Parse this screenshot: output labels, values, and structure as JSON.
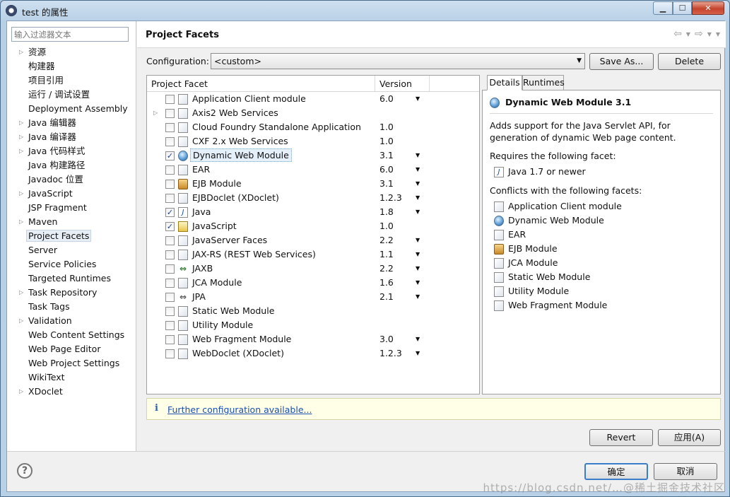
{
  "window": {
    "title": "test 的属性"
  },
  "filter": {
    "placeholder": "输入过滤器文本"
  },
  "nav": [
    {
      "label": "资源",
      "expandable": true
    },
    {
      "label": "构建器",
      "expandable": false
    },
    {
      "label": "项目引用",
      "expandable": false
    },
    {
      "label": "运行 / 调试设置",
      "expandable": false
    },
    {
      "label": "Deployment Assembly",
      "expandable": false
    },
    {
      "label": "Java 编辑器",
      "expandable": true
    },
    {
      "label": "Java 编译器",
      "expandable": true
    },
    {
      "label": "Java 代码样式",
      "expandable": true
    },
    {
      "label": "Java 构建路径",
      "expandable": false
    },
    {
      "label": "Javadoc 位置",
      "expandable": false
    },
    {
      "label": "JavaScript",
      "expandable": true
    },
    {
      "label": "JSP Fragment",
      "expandable": false
    },
    {
      "label": "Maven",
      "expandable": true
    },
    {
      "label": "Project Facets",
      "expandable": false,
      "selected": true
    },
    {
      "label": "Server",
      "expandable": false
    },
    {
      "label": "Service Policies",
      "expandable": false
    },
    {
      "label": "Targeted Runtimes",
      "expandable": false
    },
    {
      "label": "Task Repository",
      "expandable": true
    },
    {
      "label": "Task Tags",
      "expandable": false
    },
    {
      "label": "Validation",
      "expandable": true
    },
    {
      "label": "Web Content Settings",
      "expandable": false
    },
    {
      "label": "Web Page Editor",
      "expandable": false
    },
    {
      "label": "Web Project Settings",
      "expandable": false
    },
    {
      "label": "WikiText",
      "expandable": false
    },
    {
      "label": "XDoclet",
      "expandable": true
    }
  ],
  "page": {
    "title": "Project Facets"
  },
  "config": {
    "label": "Configuration:",
    "value": "<custom>",
    "save_as": "Save As...",
    "delete": "Delete"
  },
  "facets": {
    "col_facet": "Project Facet",
    "col_version": "Version",
    "rows": [
      {
        "name": "Application Client module",
        "version": "6.0",
        "checked": false,
        "dropdown": true,
        "icon": "page-icon",
        "expandable": false
      },
      {
        "name": "Axis2 Web Services",
        "version": "",
        "checked": false,
        "dropdown": false,
        "icon": "page-icon",
        "expandable": true
      },
      {
        "name": "Cloud Foundry Standalone Application",
        "version": "1.0",
        "checked": false,
        "dropdown": false,
        "icon": "page-icon",
        "expandable": false
      },
      {
        "name": "CXF 2.x Web Services",
        "version": "1.0",
        "checked": false,
        "dropdown": false,
        "icon": "page-icon",
        "expandable": false
      },
      {
        "name": "Dynamic Web Module",
        "version": "3.1",
        "checked": true,
        "dropdown": true,
        "icon": "globe-icon",
        "expandable": false,
        "selected": true
      },
      {
        "name": "EAR",
        "version": "6.0",
        "checked": false,
        "dropdown": true,
        "icon": "page-icon",
        "expandable": false
      },
      {
        "name": "EJB Module",
        "version": "3.1",
        "checked": false,
        "dropdown": true,
        "icon": "jar-icon",
        "expandable": false
      },
      {
        "name": "EJBDoclet (XDoclet)",
        "version": "1.2.3",
        "checked": false,
        "dropdown": true,
        "icon": "page-icon",
        "expandable": false
      },
      {
        "name": "Java",
        "version": "1.8",
        "checked": true,
        "dropdown": true,
        "icon": "java-icon",
        "expandable": false
      },
      {
        "name": "JavaScript",
        "version": "1.0",
        "checked": true,
        "dropdown": false,
        "icon": "js-icon",
        "expandable": false
      },
      {
        "name": "JavaServer Faces",
        "version": "2.2",
        "checked": false,
        "dropdown": true,
        "icon": "page-icon",
        "expandable": false
      },
      {
        "name": "JAX-RS (REST Web Services)",
        "version": "1.1",
        "checked": false,
        "dropdown": true,
        "icon": "page-icon",
        "expandable": false
      },
      {
        "name": "JAXB",
        "version": "2.2",
        "checked": false,
        "dropdown": true,
        "icon": "arrows-icon",
        "expandable": false
      },
      {
        "name": "JCA Module",
        "version": "1.6",
        "checked": false,
        "dropdown": true,
        "icon": "page-icon",
        "expandable": false
      },
      {
        "name": "JPA",
        "version": "2.1",
        "checked": false,
        "dropdown": true,
        "icon": "arrows-gray-icon",
        "expandable": false
      },
      {
        "name": "Static Web Module",
        "version": "",
        "checked": false,
        "dropdown": false,
        "icon": "page-icon",
        "expandable": false
      },
      {
        "name": "Utility Module",
        "version": "",
        "checked": false,
        "dropdown": false,
        "icon": "page-icon",
        "expandable": false
      },
      {
        "name": "Web Fragment Module",
        "version": "3.0",
        "checked": false,
        "dropdown": true,
        "icon": "page-icon",
        "expandable": false
      },
      {
        "name": "WebDoclet (XDoclet)",
        "version": "1.2.3",
        "checked": false,
        "dropdown": true,
        "icon": "page-icon",
        "expandable": false
      }
    ]
  },
  "details": {
    "tab_details": "Details",
    "tab_runtimes": "Runtimes",
    "title": "Dynamic Web Module 3.1",
    "description": "Adds support for the Java Servlet API, for generation of dynamic Web page content.",
    "requires_label": "Requires the following facet:",
    "requires": [
      {
        "name": "Java 1.7 or newer",
        "icon": "java-icon"
      }
    ],
    "conflicts_label": "Conflicts with the following facets:",
    "conflicts": [
      {
        "name": "Application Client module",
        "icon": "page-icon"
      },
      {
        "name": "Dynamic Web Module",
        "icon": "globe-icon"
      },
      {
        "name": "EAR",
        "icon": "page-icon"
      },
      {
        "name": "EJB Module",
        "icon": "jar-icon"
      },
      {
        "name": "JCA Module",
        "icon": "page-icon"
      },
      {
        "name": "Static Web Module",
        "icon": "page-icon"
      },
      {
        "name": "Utility Module",
        "icon": "page-icon"
      },
      {
        "name": "Web Fragment Module",
        "icon": "page-icon"
      }
    ]
  },
  "info": {
    "icon": "i",
    "link": "Further configuration available..."
  },
  "buttons": {
    "revert": "Revert",
    "apply": "应用(A)",
    "ok": "确定",
    "cancel": "取消",
    "help": "?"
  },
  "watermark": "https://blog.csdn.net/…@稀土掘金技术社区",
  "colors": {
    "link": "#1a4fb0",
    "info_bg": "#fffee6",
    "titlebar": "#b9d1e7",
    "close_button": "#c4432b"
  }
}
